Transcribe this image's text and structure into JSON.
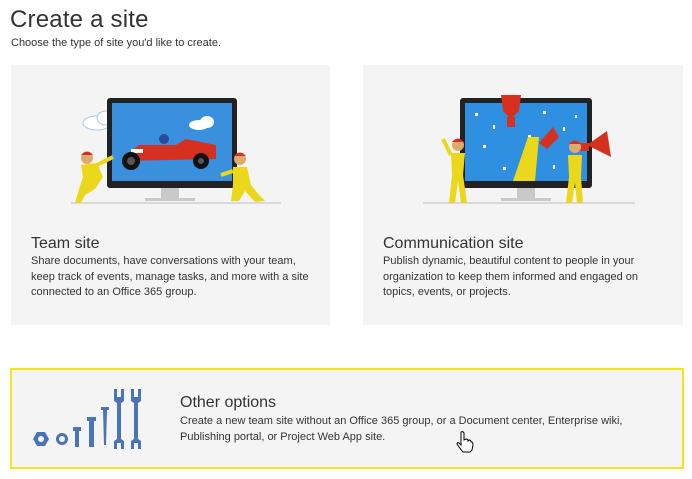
{
  "page": {
    "title": "Create a site",
    "subtitle": "Choose the type of site you'd like to create."
  },
  "cards": [
    {
      "title": "Team site",
      "description": "Share documents, have conversations with your team, keep track of events, manage tasks, and more with a site connected to an Office 365 group."
    },
    {
      "title": "Communication site",
      "description": "Publish dynamic, beautiful content to people in your organization to keep them informed and engaged on topics, events, or projects."
    }
  ],
  "other": {
    "title": "Other options",
    "description": "Create a new team site without an Office 365 group, or a Document center, Enterprise wiki, Publishing portal, or Project Web App site.",
    "icon": "tools-icon"
  },
  "colors": {
    "card_bg": "#f4f4f4",
    "highlight_border": "#f5e61a",
    "tool_blue": "#4a74b5",
    "screen_blue": "#2f8fe0",
    "figure_yellow": "#ecd81a",
    "accent_red": "#d63020"
  }
}
